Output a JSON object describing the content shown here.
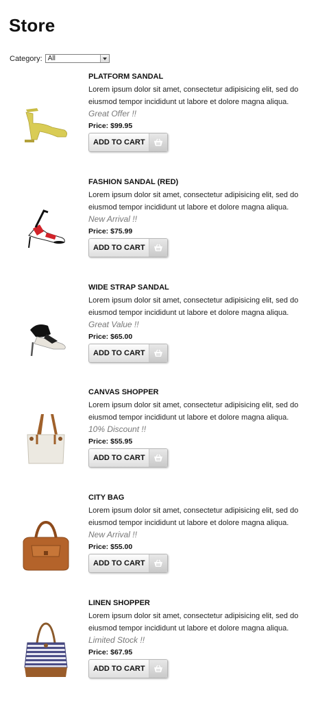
{
  "page": {
    "title": "Store"
  },
  "filter": {
    "label": "Category:",
    "selected": "All"
  },
  "cart_button_label": "ADD TO CART",
  "products": [
    {
      "name": "PLATFORM SANDAL",
      "desc": "Lorem ipsum dolor sit amet, consectetur adipisicing elit, sed do eiusmod tempor incididunt ut labore et dolore magna aliqua.",
      "offer": "Great Offer !!",
      "price": "Price: $99.95",
      "image": "yellow-platform-sandal"
    },
    {
      "name": "FASHION SANDAL (RED)",
      "desc": "Lorem ipsum dolor sit amet, consectetur adipisicing elit, sed do eiusmod tempor incididunt ut labore et dolore magna aliqua.",
      "offer": "New Arrival !!",
      "price": "Price: $75.99",
      "image": "red-strappy-sandal"
    },
    {
      "name": "WIDE STRAP SANDAL",
      "desc": "Lorem ipsum dolor sit amet, consectetur adipisicing elit, sed do eiusmod tempor incididunt ut labore et dolore magna aliqua.",
      "offer": "Great Value !!",
      "price": "Price: $65.00",
      "image": "black-wide-strap-sandal"
    },
    {
      "name": "CANVAS SHOPPER",
      "desc": "Lorem ipsum dolor sit amet, consectetur adipisicing elit, sed do eiusmod tempor incididunt ut labore et dolore magna aliqua.",
      "offer": "10% Discount !!",
      "price": "Price: $55.95",
      "image": "canvas-tote-bag"
    },
    {
      "name": "CITY BAG",
      "desc": "Lorem ipsum dolor sit amet, consectetur adipisicing elit, sed do eiusmod tempor incididunt ut labore et dolore magna aliqua.",
      "offer": "New Arrival !!",
      "price": "Price: $55.00",
      "image": "brown-leather-city-bag"
    },
    {
      "name": "LINEN SHOPPER",
      "desc": "Lorem ipsum dolor sit amet, consectetur adipisicing elit, sed do eiusmod tempor incididunt ut labore et dolore magna aliqua.",
      "offer": "Limited Stock !!",
      "price": "Price: $67.95",
      "image": "striped-linen-shopper"
    }
  ]
}
